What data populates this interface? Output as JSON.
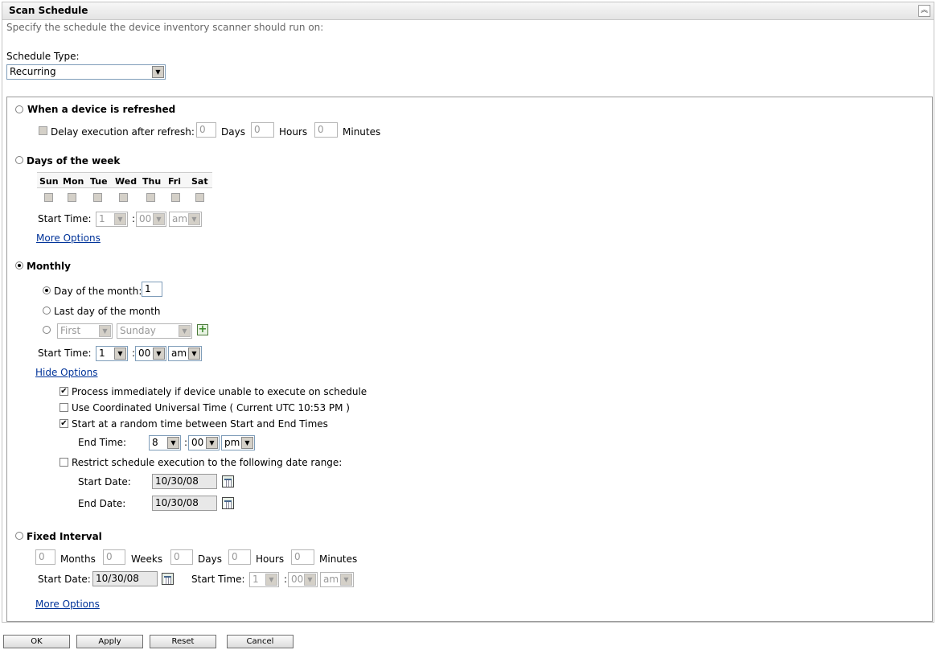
{
  "header": {
    "title": "Scan Schedule",
    "description": "Specify the schedule the device inventory scanner should run on:"
  },
  "schedule_type": {
    "label": "Schedule Type:",
    "value": "Recurring"
  },
  "refreshed": {
    "label": "When a device is refreshed",
    "delay_label": "Delay execution after refresh:",
    "days_value": "0",
    "days_unit": "Days",
    "hours_value": "0",
    "hours_unit": "Hours",
    "minutes_value": "0",
    "minutes_unit": "Minutes"
  },
  "days_of_week": {
    "label": "Days of the week",
    "days": [
      "Sun",
      "Mon",
      "Tue",
      "Wed",
      "Thu",
      "Fri",
      "Sat"
    ],
    "start_time_label": "Start Time:",
    "hour": "1",
    "minute": "00",
    "ampm": "am",
    "more_options": "More Options"
  },
  "monthly": {
    "label": "Monthly",
    "day_of_month_label": "Day of the month:",
    "day_of_month_value": "1",
    "last_day_label": "Last day of the month",
    "ordinal": "First",
    "weekday": "Sunday",
    "start_time_label": "Start Time:",
    "hour": "1",
    "minute": "00",
    "ampm": "am",
    "hide_options": "Hide Options",
    "opt_process": "Process immediately if device unable to execute on schedule",
    "opt_utc": "Use Coordinated Universal Time ( Current UTC 10:53 PM )",
    "opt_random": "Start at a random time between Start and End Times",
    "end_time_label": "End Time:",
    "end_hour": "8",
    "end_minute": "00",
    "end_ampm": "pm",
    "opt_restrict": "Restrict schedule execution to the following date range:",
    "start_date_label": "Start Date:",
    "start_date": "10/30/08",
    "end_date_label": "End Date:",
    "end_date": "10/30/08"
  },
  "fixed": {
    "label": "Fixed Interval",
    "months_value": "0",
    "months_unit": "Months",
    "weeks_value": "0",
    "weeks_unit": "Weeks",
    "days_value": "0",
    "days_unit": "Days",
    "hours_value": "0",
    "hours_unit": "Hours",
    "minutes_value": "0",
    "minutes_unit": "Minutes",
    "start_date_label": "Start Date:",
    "start_date": "10/30/08",
    "start_time_label": "Start Time:",
    "hour": "1",
    "minute": "00",
    "ampm": "am",
    "more_options": "More Options"
  },
  "buttons": {
    "ok": "OK",
    "apply": "Apply",
    "reset": "Reset",
    "cancel": "Cancel"
  },
  "colon": ":",
  "icons": {
    "collapse": "double-chevron-up-icon",
    "calendar": "calendar-icon",
    "add": "add-icon"
  }
}
